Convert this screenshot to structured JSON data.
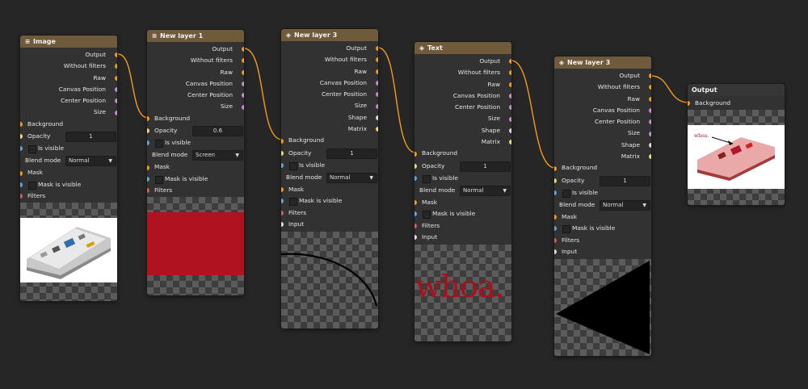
{
  "nodes": {
    "image": {
      "title": "Image",
      "icon": "stack-icon",
      "outputs": [
        "Output",
        "Without filters",
        "Raw",
        "Canvas Position",
        "Center Position",
        "Size"
      ],
      "background": "Background",
      "opacity_label": "Opacity",
      "opacity_value": "1",
      "is_visible": "Is visible",
      "blend_label": "Blend mode",
      "blend_value": "Normal",
      "mask": "Mask",
      "mask_visible": "Mask is visible",
      "filters": "Filters"
    },
    "layer1": {
      "title": "New layer 1",
      "icon": "stack-icon",
      "outputs": [
        "Output",
        "Without filters",
        "Raw",
        "Canvas Position",
        "Center Position",
        "Size"
      ],
      "background": "Background",
      "opacity_label": "Opacity",
      "opacity_value": "0.6",
      "is_visible": "Is visible",
      "blend_label": "Blend mode",
      "blend_value": "Screen",
      "mask": "Mask",
      "mask_visible": "Mask is visible",
      "filters": "Filters"
    },
    "layer3a": {
      "title": "New layer 3",
      "icon": "tag-icon",
      "outputs": [
        "Output",
        "Without filters",
        "Raw",
        "Canvas Position",
        "Center Position",
        "Size",
        "Shape",
        "Matrix"
      ],
      "background": "Background",
      "opacity_label": "Opacity",
      "opacity_value": "1",
      "is_visible": "Is visible",
      "blend_label": "Blend mode",
      "blend_value": "Normal",
      "mask": "Mask",
      "mask_visible": "Mask is visible",
      "filters": "Filters",
      "input": "Input"
    },
    "text": {
      "title": "Text",
      "icon": "tag-icon",
      "outputs": [
        "Output",
        "Without filters",
        "Raw",
        "Canvas Position",
        "Center Position",
        "Size",
        "Shape",
        "Matrix"
      ],
      "background": "Background",
      "opacity_label": "Opacity",
      "opacity_value": "1",
      "is_visible": "Is visible",
      "blend_label": "Blend mode",
      "blend_value": "Normal",
      "mask": "Mask",
      "mask_visible": "Mask is visible",
      "filters": "Filters",
      "input": "Input",
      "preview_text": "whoa."
    },
    "layer3b": {
      "title": "New layer 3",
      "icon": "tag-icon",
      "outputs": [
        "Output",
        "Without filters",
        "Raw",
        "Canvas Position",
        "Center Position",
        "Size",
        "Shape",
        "Matrix"
      ],
      "background": "Background",
      "opacity_label": "Opacity",
      "opacity_value": "1",
      "is_visible": "Is visible",
      "blend_label": "Blend mode",
      "blend_value": "Normal",
      "mask": "Mask",
      "mask_visible": "Mask is visible",
      "filters": "Filters",
      "input": "Input"
    },
    "output": {
      "title": "Output",
      "input": "Background",
      "preview_text": "whoa."
    }
  },
  "colors": {
    "canvas": "#262626",
    "node_body": "#323232",
    "node_header": "#705a3c",
    "port_image": "#f29c1d",
    "port_vector": "#c98bd4",
    "port_number": "#f3d67a",
    "port_bool": "#5fa8d8",
    "port_filters": "#d06060",
    "port_shape": "#e8d4e8",
    "wire": "#f29c1d",
    "red_fill": "#b1121f"
  }
}
